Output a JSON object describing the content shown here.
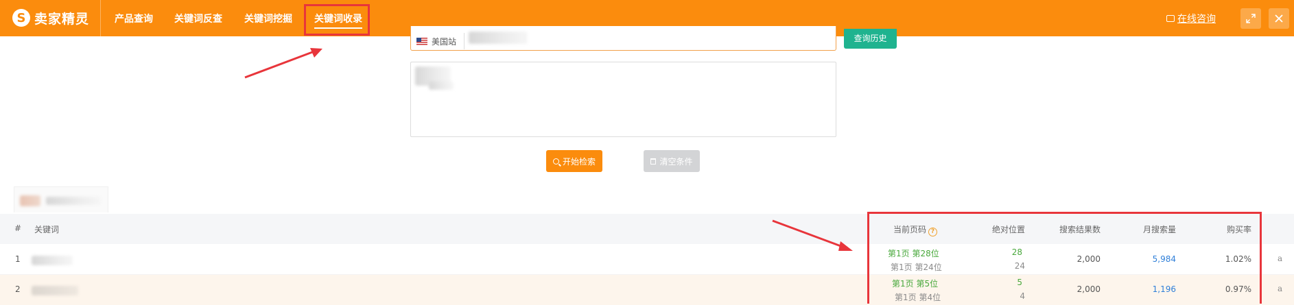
{
  "header": {
    "logo_mark": "S",
    "logo_text": "卖家精灵",
    "nav": [
      {
        "label": "产品查询"
      },
      {
        "label": "关键词反查"
      },
      {
        "label": "关键词挖掘"
      },
      {
        "label": "关键词收录",
        "active": true
      }
    ],
    "consult_label": "在线咨询",
    "colors": {
      "brand": "#fb8c0d",
      "annotation_red": "#e8353b"
    }
  },
  "search": {
    "site_label": "美国站",
    "history_button": "查询历史",
    "start_button": "开始检索",
    "clear_button": "清空条件"
  },
  "table": {
    "headers": {
      "index": "#",
      "keyword": "关键词",
      "current_page": "当前页码",
      "absolute_position": "绝对位置",
      "search_results": "搜索结果数",
      "monthly_searches": "月搜索量",
      "purchase_rate": "购买率"
    },
    "help_icon_glyph": "?",
    "rows": [
      {
        "index": "1",
        "current_page": "第1页 第28位",
        "prev_page": "第1页 第24位",
        "absolute_position": "28",
        "prev_absolute_position": "24",
        "search_results": "2,000",
        "monthly_searches": "5,984",
        "purchase_rate": "1.02%",
        "amazon_glyph": "a"
      },
      {
        "index": "2",
        "current_page": "第1页 第5位",
        "prev_page": "第1页 第4位",
        "absolute_position": "5",
        "prev_absolute_position": "4",
        "search_results": "2,000",
        "monthly_searches": "1,196",
        "purchase_rate": "0.97%",
        "amazon_glyph": "a"
      }
    ]
  }
}
